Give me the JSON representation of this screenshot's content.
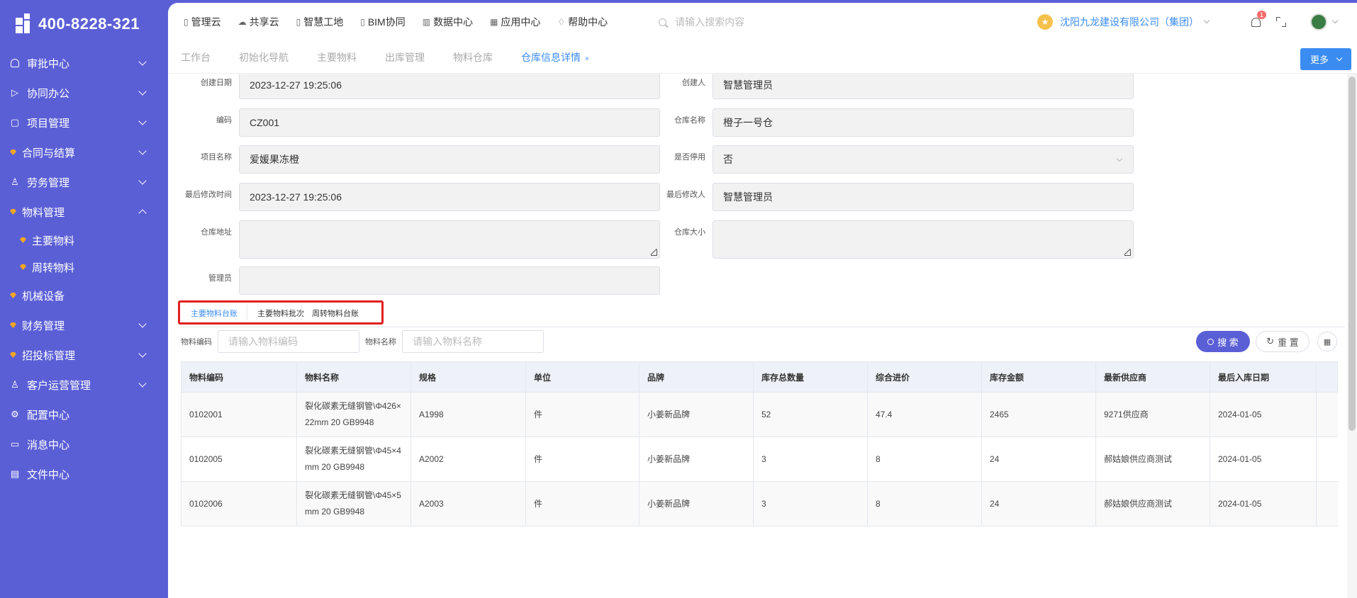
{
  "brand": {
    "phone": "400-8228-321"
  },
  "sidebar": {
    "items": [
      {
        "label": "审批中心"
      },
      {
        "label": "协同办公"
      },
      {
        "label": "项目管理"
      },
      {
        "label": "合同与结算"
      },
      {
        "label": "劳务管理"
      },
      {
        "label": "物料管理"
      },
      {
        "label": "主要物料"
      },
      {
        "label": "周转物料"
      },
      {
        "label": "机械设备"
      },
      {
        "label": "财务管理"
      },
      {
        "label": "招投标管理"
      },
      {
        "label": "客户运营管理"
      },
      {
        "label": "配置中心"
      },
      {
        "label": "消息中心"
      },
      {
        "label": "文件中心"
      }
    ]
  },
  "topnav": {
    "menus": [
      {
        "label": "管理云"
      },
      {
        "label": "共享云"
      },
      {
        "label": "智慧工地"
      },
      {
        "label": "BIM协同"
      },
      {
        "label": "数据中心"
      },
      {
        "label": "应用中心"
      },
      {
        "label": "帮助中心"
      }
    ],
    "search_placeholder": "请输入搜索内容",
    "company": "沈阳九龙建设有限公司（集团）",
    "notification_count": "1"
  },
  "tabs": {
    "items": [
      {
        "label": "工作台"
      },
      {
        "label": "初始化导航"
      },
      {
        "label": "主要物料"
      },
      {
        "label": "出库管理"
      },
      {
        "label": "物料仓库"
      },
      {
        "label": "仓库信息详情"
      }
    ],
    "close": "×",
    "more": "更多"
  },
  "form": {
    "create_date_label": "创建日期",
    "create_date": "2023-12-27 19:25:06",
    "creator_label": "创建人",
    "creator": "智慧管理员",
    "code_label": "编码",
    "code": "CZ001",
    "warehouse_name_label": "仓库名称",
    "warehouse_name": "橙子一号仓",
    "project_label": "项目名称",
    "project": "爱媛果冻橙",
    "disabled_label": "是否停用",
    "disabled": "否",
    "modified_time_label": "最后修改时间",
    "modified_time": "2023-12-27 19:25:06",
    "modifier_label": "最后修改人",
    "modifier": "智慧管理员",
    "address_label": "仓库地址",
    "size_label": "仓库大小",
    "manager_label": "管理员"
  },
  "subtabs": {
    "items": [
      {
        "label": "主要物料台账"
      },
      {
        "label": "主要物料批次"
      },
      {
        "label": "周转物料台账"
      }
    ]
  },
  "filter": {
    "code_label": "物料编码",
    "code_placeholder": "请输入物料编码",
    "name_label": "物料名称",
    "name_placeholder": "请输入物料名称",
    "search_btn": "搜 索",
    "reset_btn": "重 置"
  },
  "table": {
    "columns": [
      "物料编码",
      "物料名称",
      "规格",
      "单位",
      "品牌",
      "库存总数量",
      "综合进价",
      "库存金额",
      "最新供应商",
      "最后入库日期"
    ],
    "rows": [
      [
        "0102001",
        "裂化碳素无缝钢管\\Φ426×22mm 20 GB9948",
        "A1998",
        "件",
        "小姜新品牌",
        "52",
        "47.4",
        "2465",
        "9271供应商",
        "2024-01-05"
      ],
      [
        "0102005",
        "裂化碳素无缝钢管\\Φ45×4mm 20 GB9948",
        "A2002",
        "件",
        "小姜新品牌",
        "3",
        "8",
        "24",
        "郝姑娘供应商测试",
        "2024-01-05"
      ],
      [
        "0102006",
        "裂化碳素无缝钢管\\Φ45×5mm 20 GB9948",
        "A2003",
        "件",
        "小姜新品牌",
        "3",
        "8",
        "24",
        "郝姑娘供应商测试",
        "2024-01-05"
      ]
    ]
  },
  "colors": {
    "sidebar_bg": "#5b5fd6",
    "accent": "#3b8cf0",
    "highlight_box": "#e02020"
  }
}
